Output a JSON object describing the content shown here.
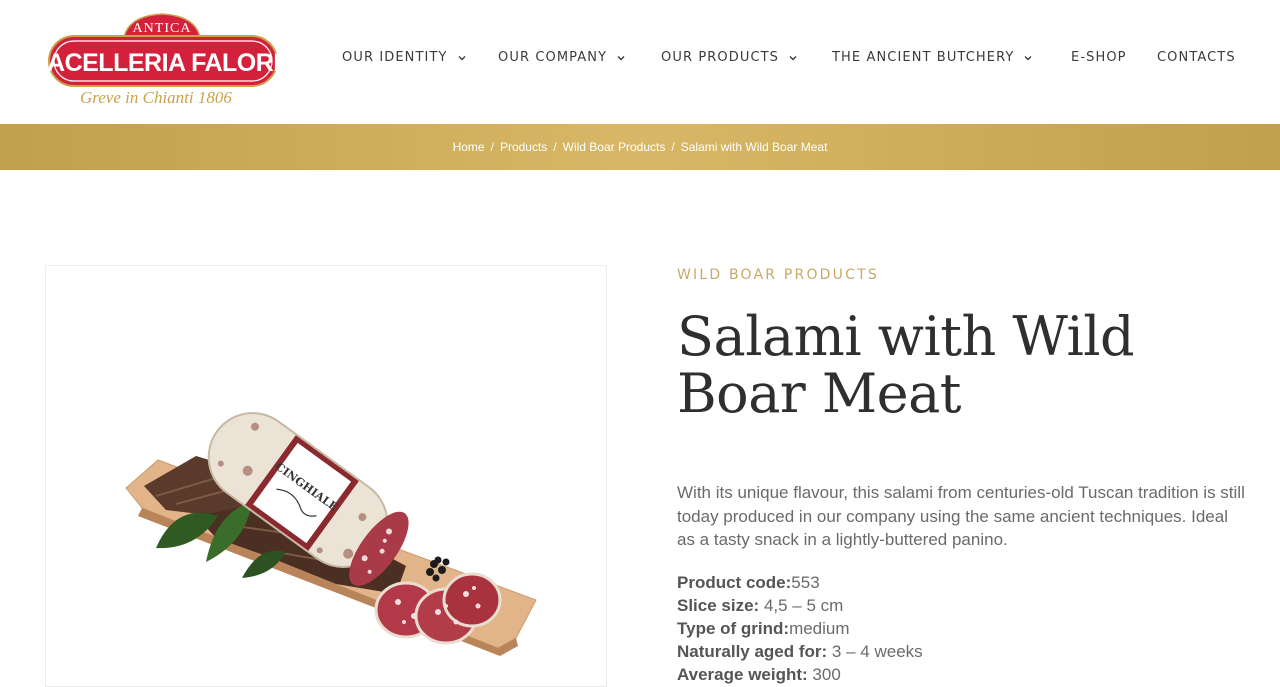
{
  "logo": {
    "top_text": "ANTICA",
    "name": "MACELLERIA FALORNI",
    "tagline": "Greve in Chianti 1806"
  },
  "nav": [
    {
      "label": "OUR IDENTITY",
      "dropdown": true
    },
    {
      "label": "OUR COMPANY",
      "dropdown": true
    },
    {
      "label": "OUR PRODUCTS",
      "dropdown": true
    },
    {
      "label": "THE ANCIENT BUTCHERY",
      "dropdown": true
    },
    {
      "label": "E-SHOP",
      "dropdown": false
    },
    {
      "label": "CONTACTS",
      "dropdown": false
    }
  ],
  "breadcrumb": [
    "Home",
    "Products",
    "Wild Boar Products",
    "Salami with Wild Boar Meat"
  ],
  "product": {
    "category": "WILD BOAR PRODUCTS",
    "title": "Salami with Wild Boar Meat",
    "label_text": "CINGHIALE",
    "description": "With its unique flavour, this salami from centuries-old Tuscan tradition is still today produced in our company using the same ancient techniques. Ideal as a tasty snack in a lightly-buttered panino.",
    "specs": [
      {
        "label": "Product code:",
        "value": "553"
      },
      {
        "label": "Slice size:",
        "value": " 4,5 – 5 cm"
      },
      {
        "label": "Type of grind:",
        "value": "medium"
      },
      {
        "label": "Naturally aged for:",
        "value": " 3 – 4 weeks"
      },
      {
        "label": "Average weight:",
        "value": " 300"
      }
    ]
  },
  "colors": {
    "gold": "#c9a24a",
    "logo_red": "#d4213b",
    "breadcrumb_bar": "#c9a855"
  }
}
